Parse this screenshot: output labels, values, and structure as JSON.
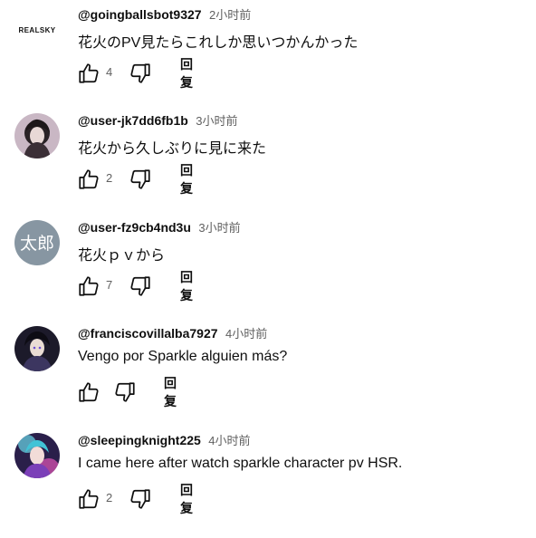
{
  "comments": [
    {
      "author": "@goingballsbot9327",
      "time": "2小时前",
      "text": "花火のPV見たらこれしか思いつかんかった",
      "likes": "4",
      "reply_label": "回复",
      "avatar": {
        "type": "logo",
        "text": "REALSKY"
      }
    },
    {
      "author": "@user-jk7dd6fb1b",
      "time": "3小时前",
      "text": "花火から久しぶりに見に来た",
      "likes": "2",
      "reply_label": "回复",
      "avatar": {
        "type": "image",
        "desc": "dark-haired-figure-avatar"
      }
    },
    {
      "author": "@user-fz9cb4nd3u",
      "time": "3小时前",
      "text": "花火ｐｖから",
      "likes": "7",
      "reply_label": "回复",
      "avatar": {
        "type": "initials",
        "text": "太郎",
        "color": "#8796a2"
      }
    },
    {
      "author": "@franciscovillalba7927",
      "time": "4小时前",
      "text": "Vengo por Sparkle alguien más?",
      "likes": "",
      "reply_label": "回复",
      "avatar": {
        "type": "image",
        "desc": "anime-character-avatar"
      }
    },
    {
      "author": "@sleepingknight225",
      "time": "4小时前",
      "text": "I came here after watch sparkle character pv HSR.",
      "likes": "2",
      "reply_label": "回复",
      "avatar": {
        "type": "image",
        "desc": "neon-anime-avatar"
      }
    }
  ],
  "icons": {
    "like": "thumbs-up-icon",
    "dislike": "thumbs-down-icon"
  }
}
